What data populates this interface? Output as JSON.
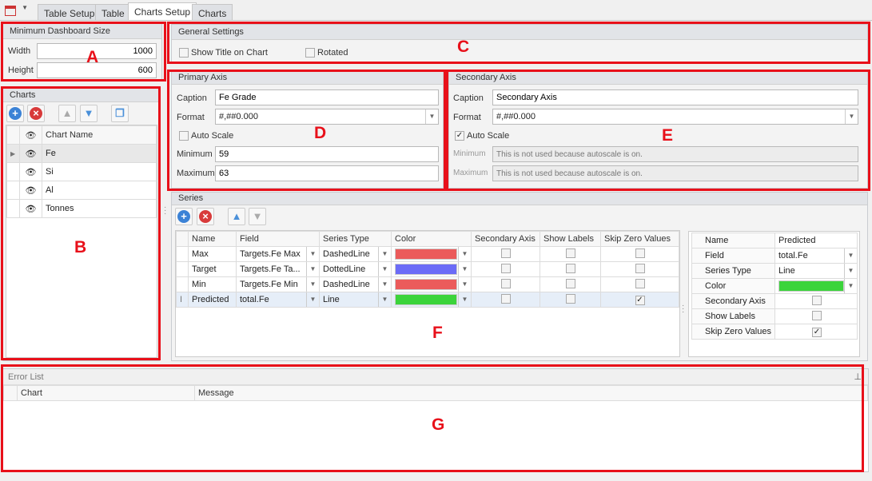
{
  "tabs": [
    "Table Setup",
    "Table",
    "Charts Setup",
    "Charts"
  ],
  "active_tab": "Charts Setup",
  "min_size": {
    "title": "Minimum Dashboard Size",
    "width_label": "Width",
    "width": "1000",
    "height_label": "Height",
    "height": "600"
  },
  "charts": {
    "title": "Charts",
    "header": "Chart Name",
    "items": [
      "Fe",
      "Si",
      "Al",
      "Tonnes"
    ],
    "selected": "Fe"
  },
  "general": {
    "title": "General Settings",
    "show_title": "Show Title on Chart",
    "rotated": "Rotated"
  },
  "primary": {
    "title": "Primary Axis",
    "caption_label": "Caption",
    "caption": "Fe Grade",
    "format_label": "Format",
    "format": "#,##0.000",
    "auto_scale": "Auto Scale",
    "min_label": "Minimum",
    "min": "59",
    "max_label": "Maximum",
    "max": "63"
  },
  "secondary": {
    "title": "Secondary Axis",
    "caption_label": "Caption",
    "caption": "Secondary Axis",
    "format_label": "Format",
    "format": "#,##0.000",
    "auto_scale": "Auto Scale",
    "min_label": "Minimum",
    "min": "This is not used because autoscale is on.",
    "max_label": "Maximum",
    "max": "This is not used because autoscale is on."
  },
  "series": {
    "title": "Series",
    "columns": [
      "Name",
      "Field",
      "Series Type",
      "Color",
      "Secondary Axis",
      "Show Labels",
      "Skip Zero Values"
    ],
    "rows": [
      {
        "name": "Max",
        "field": "Targets.Fe Max",
        "type": "DashedLine",
        "color": "#eb5b5b",
        "secondary": false,
        "labels": false,
        "skip": false
      },
      {
        "name": "Target",
        "field": "Targets.Fe Ta...",
        "type": "DottedLine",
        "color": "#6b6bf7",
        "secondary": false,
        "labels": false,
        "skip": false
      },
      {
        "name": "Min",
        "field": "Targets.Fe Min",
        "type": "DashedLine",
        "color": "#eb5b5b",
        "secondary": false,
        "labels": false,
        "skip": false
      },
      {
        "name": "Predicted",
        "field": "total.Fe",
        "type": "Line",
        "color": "#3bd43b",
        "secondary": false,
        "labels": false,
        "skip": true
      }
    ]
  },
  "props": {
    "rows": [
      [
        "Name",
        "Predicted"
      ],
      [
        "Field",
        "total.Fe"
      ],
      [
        "Series Type",
        "Line"
      ],
      [
        "Color",
        ""
      ],
      [
        "Secondary Axis",
        ""
      ],
      [
        "Show Labels",
        ""
      ],
      [
        "Skip Zero Values",
        ""
      ]
    ]
  },
  "errors": {
    "title": "Error List",
    "columns": [
      "Chart",
      "Message"
    ]
  },
  "annotations": [
    "A",
    "B",
    "C",
    "D",
    "E",
    "F",
    "G"
  ]
}
